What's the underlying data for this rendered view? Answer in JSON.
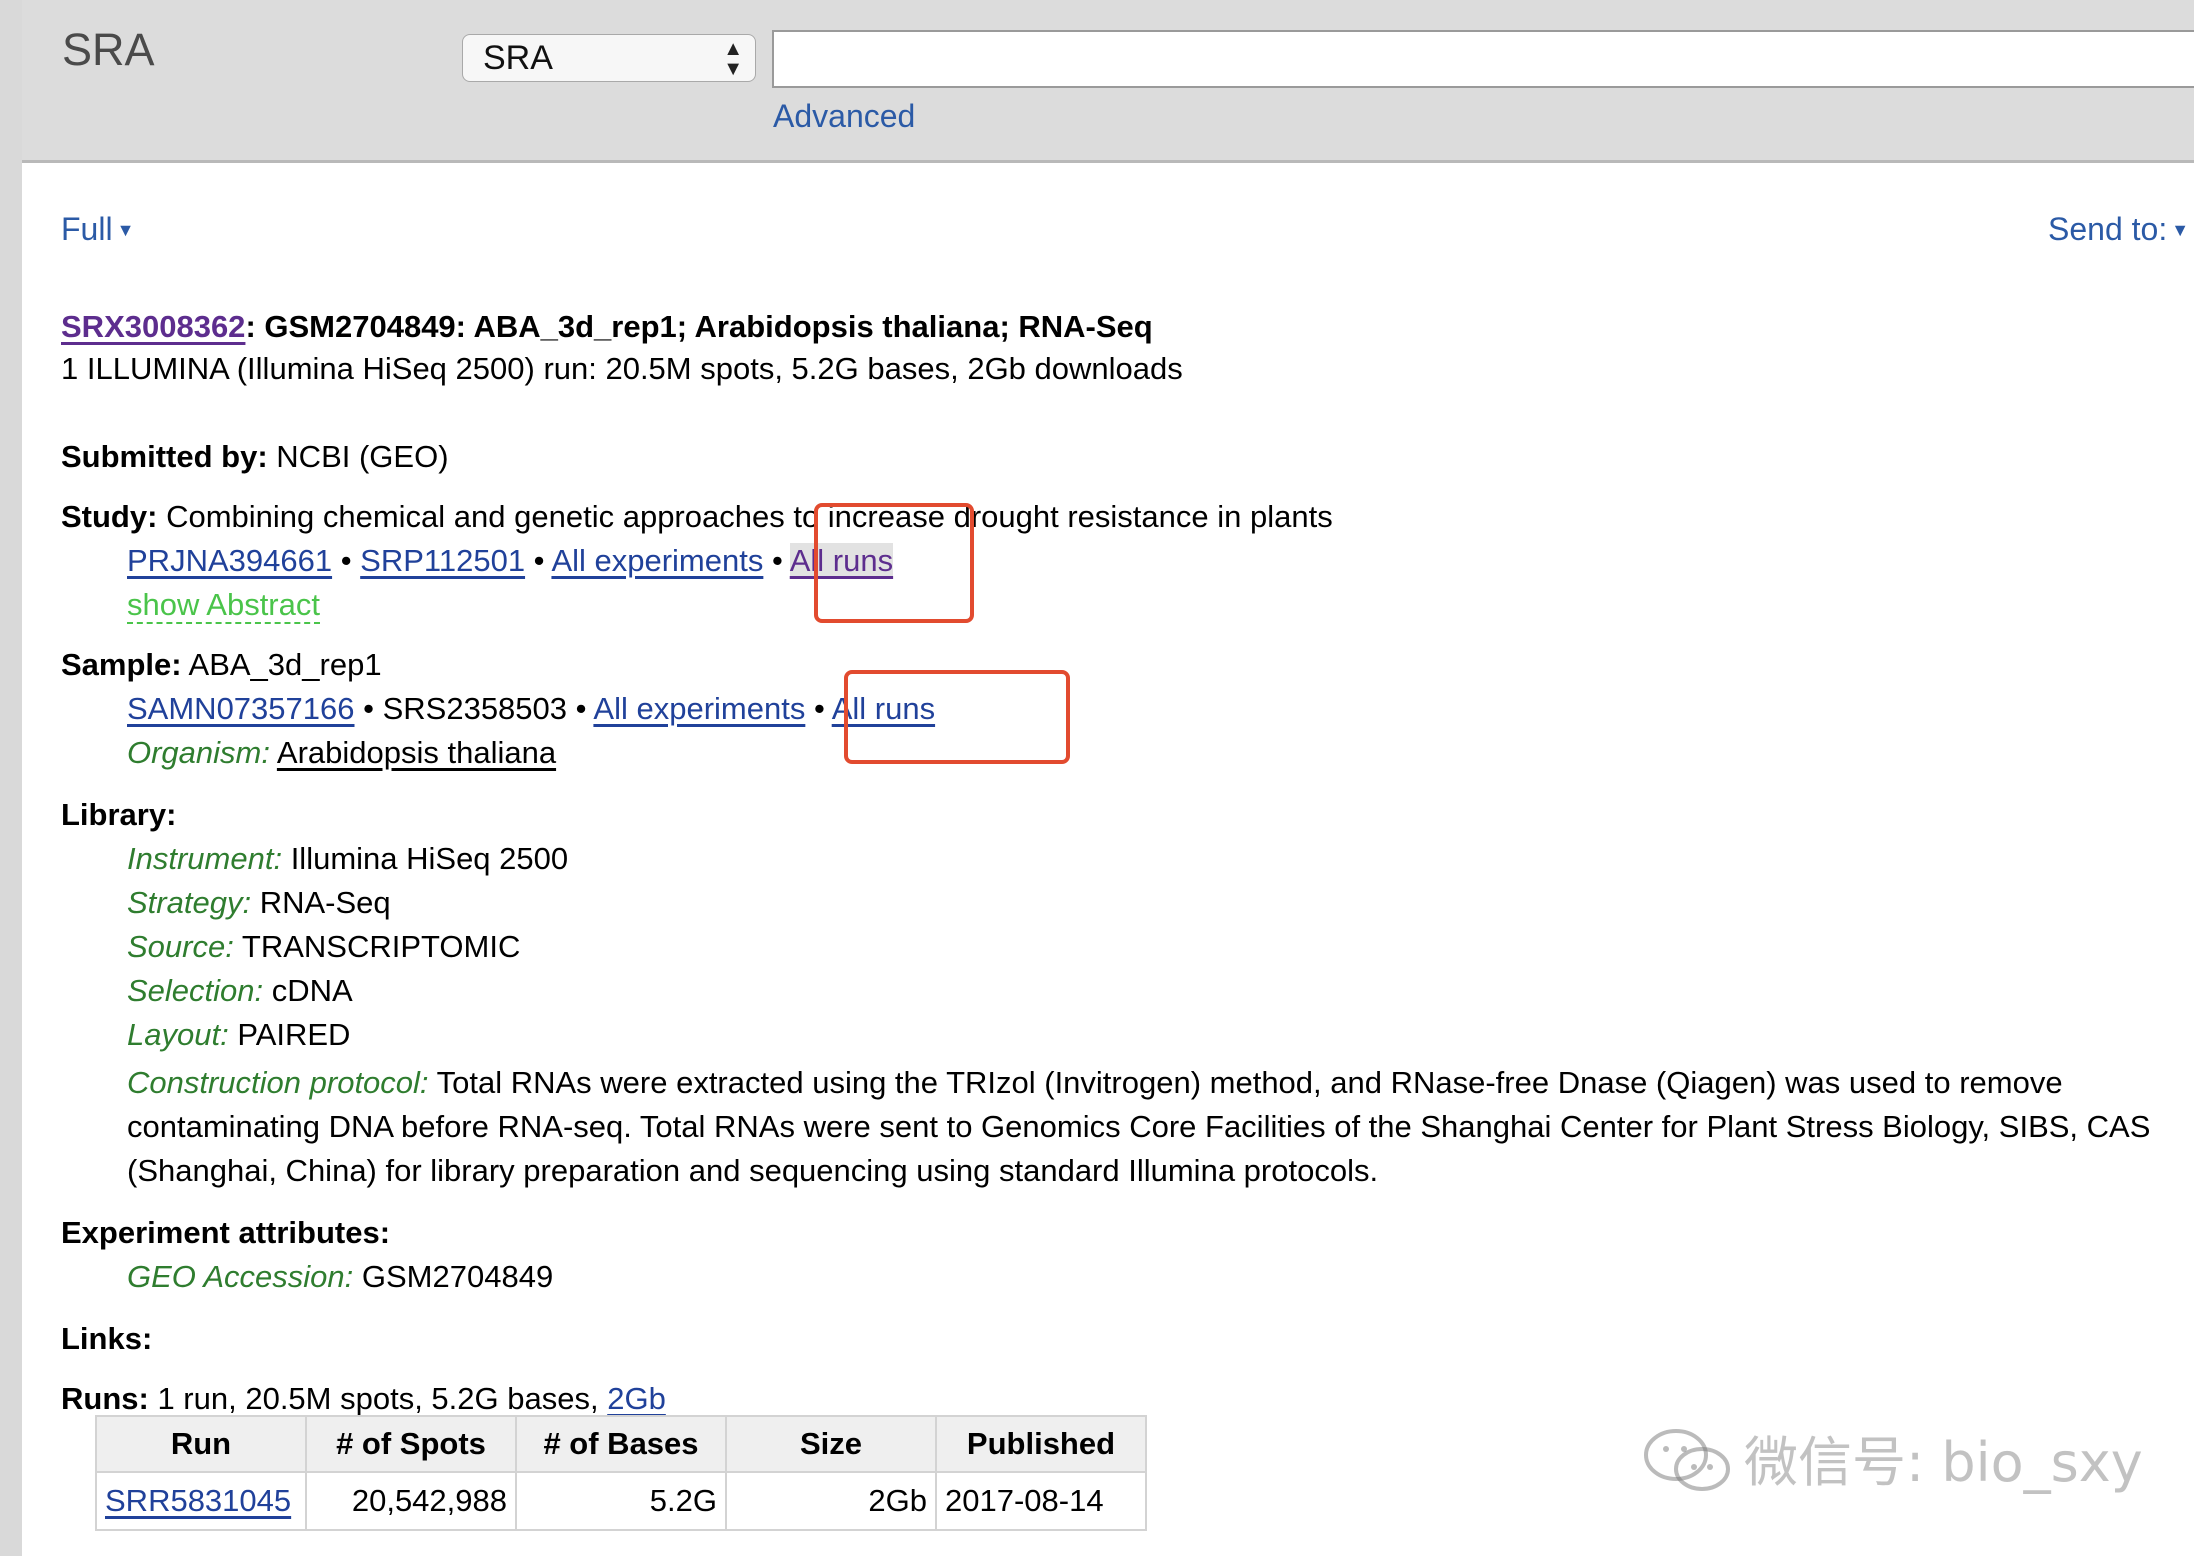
{
  "header": {
    "title": "SRA",
    "db_select": "SRA",
    "search_value": "",
    "advanced": "Advanced"
  },
  "toolbar": {
    "format": "Full",
    "send_to": "Send to:"
  },
  "record": {
    "accession": "SRX3008362",
    "title_rest": ": GSM2704849: ABA_3d_rep1; Arabidopsis thaliana; RNA-Seq",
    "summary": "1 ILLUMINA (Illumina HiSeq 2500) run: 20.5M spots, 5.2G bases, 2Gb downloads"
  },
  "submitted": {
    "label": "Submitted by:",
    "value": "NCBI (GEO)"
  },
  "study": {
    "label": "Study:",
    "value": "Combining chemical and genetic approaches to increase drought resistance in plants",
    "links": [
      "PRJNA394661",
      "SRP112501",
      "All experiments",
      "All runs"
    ],
    "show_abstract": "show Abstract"
  },
  "sample": {
    "label": "Sample:",
    "value": "ABA_3d_rep1",
    "link1": "SAMN07357166",
    "plain": "SRS2358503",
    "link2": "All experiments",
    "link3": "All runs",
    "organism_label": "Organism:",
    "organism": "Arabidopsis thaliana"
  },
  "library": {
    "label": "Library:",
    "instrument_label": "Instrument:",
    "instrument": "Illumina HiSeq 2500",
    "strategy_label": "Strategy:",
    "strategy": "RNA-Seq",
    "source_label": "Source:",
    "source": "TRANSCRIPTOMIC",
    "selection_label": "Selection:",
    "selection": "cDNA",
    "layout_label": "Layout:",
    "layout": "PAIRED",
    "protocol_label": "Construction protocol:",
    "protocol": "Total RNAs were extracted using the TRIzol (Invitrogen) method, and RNase-free Dnase (Qiagen) was used to remove contaminating DNA before RNA-seq. Total RNAs were sent to Genomics Core Facilities of the Shanghai Center for Plant Stress Biology, SIBS, CAS (Shanghai, China) for library preparation and sequencing using standard Illumina protocols."
  },
  "attributes": {
    "label": "Experiment attributes:",
    "geo_label": "GEO Accession:",
    "geo": "GSM2704849"
  },
  "links_label": "Links:",
  "runs": {
    "label": "Runs:",
    "summary": "1 run, 20.5M spots, 5.2G bases,",
    "size_link": "2Gb",
    "columns": [
      "Run",
      "# of Spots",
      "# of Bases",
      "Size",
      "Published"
    ],
    "rows": [
      [
        "SRR5831045",
        "20,542,988",
        "5.2G",
        "2Gb",
        "2017-08-14"
      ]
    ]
  },
  "watermark": "微信号: bio_sxy",
  "colors": {
    "annotation_box": "#e24b2f",
    "link": "#20419a",
    "label_green": "#2f7d2f"
  }
}
